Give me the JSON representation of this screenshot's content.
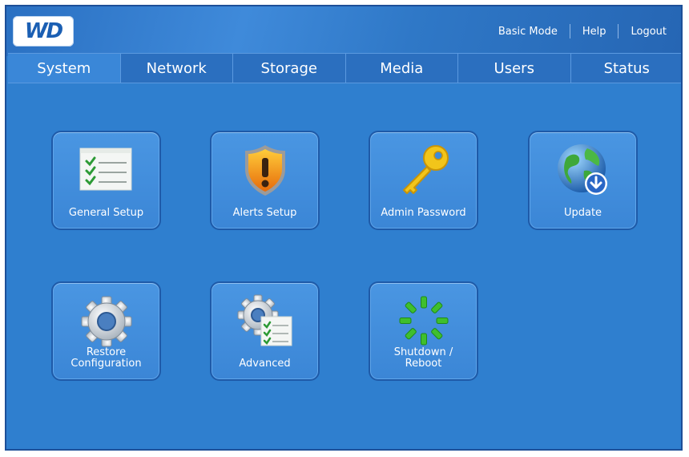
{
  "header": {
    "logo_text": "WD",
    "links": {
      "basic_mode": "Basic Mode",
      "help": "Help",
      "logout": "Logout"
    }
  },
  "tabs": [
    {
      "label": "System",
      "active": true
    },
    {
      "label": "Network"
    },
    {
      "label": "Storage"
    },
    {
      "label": "Media"
    },
    {
      "label": "Users"
    },
    {
      "label": "Status"
    }
  ],
  "tiles": {
    "general_setup": {
      "label": "General Setup",
      "icon": "checklist-icon"
    },
    "alerts_setup": {
      "label": "Alerts Setup",
      "icon": "warning-shield-icon"
    },
    "admin_password": {
      "label": "Admin Password",
      "icon": "key-icon"
    },
    "update": {
      "label": "Update",
      "icon": "globe-download-icon"
    },
    "restore_configuration": {
      "label_line1": "Restore",
      "label_line2": "Configuration",
      "icon": "gear-icon"
    },
    "advanced": {
      "label": "Advanced",
      "icon": "gear-checklist-icon"
    },
    "shutdown_reboot": {
      "label_line1": "Shutdown /",
      "label_line2": "Reboot",
      "icon": "power-spinner-icon"
    }
  },
  "colors": {
    "background": "#2f7fcf",
    "tile": "#3f8bd9",
    "border": "#1e5aa8",
    "text": "#ffffff"
  }
}
